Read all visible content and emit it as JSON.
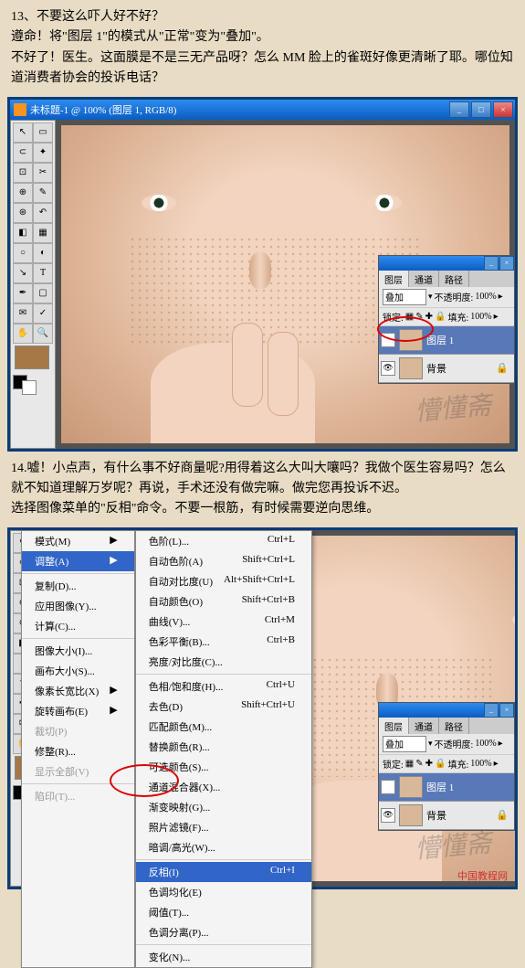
{
  "step13": {
    "heading": "13、不要这么吓人好不好？",
    "line2": "遵命！将\"图层 1\"的模式从\"正常\"变为\"叠加\"。",
    "line3": "不好了！医生。这面膜是不是三无产品呀？怎么 MM 脸上的雀斑好像更清晰了耶。哪位知道消费者协会的投诉电话？"
  },
  "step14": {
    "line1": "14.嘘！小点声，有什么事不好商量呢?用得着这么大叫大嚷吗？我做个医生容易吗？怎么就不知道理解万岁呢？再说，手术还没有做完嘛。做完您再投诉不迟。",
    "line2": "选择图像菜单的\"反相\"命令。不要一根筋，有时候需要逆向思维。"
  },
  "window": {
    "title": "未标题-1 @ 100% (图层 1, RGB/8)"
  },
  "layers": {
    "tab1": "图层",
    "tab2": "通道",
    "tab3": "路径",
    "blend": "叠加",
    "opacity_label": "不透明度:",
    "opacity": "100%",
    "lock_label": "锁定:",
    "fill_label": "填充:",
    "fill": "100%",
    "layer1": "图层 1",
    "background": "背景"
  },
  "menu1": {
    "items": [
      {
        "l": "模式(M)",
        "a": "▶"
      },
      {
        "l": "调整(A)",
        "a": "▶",
        "sel": true
      },
      {
        "sep": true
      },
      {
        "l": "复制(D)...",
        "a": ""
      },
      {
        "l": "应用图像(Y)...",
        "a": ""
      },
      {
        "l": "计算(C)...",
        "a": ""
      },
      {
        "sep": true
      },
      {
        "l": "图像大小(I)...",
        "a": ""
      },
      {
        "l": "画布大小(S)...",
        "a": ""
      },
      {
        "l": "像素长宽比(X)",
        "a": "▶"
      },
      {
        "l": "旋转画布(E)",
        "a": "▶"
      },
      {
        "l": "裁切(P)",
        "a": "",
        "dis": true
      },
      {
        "l": "修整(R)...",
        "a": ""
      },
      {
        "l": "显示全部(V)",
        "a": "",
        "dis": true
      },
      {
        "sep": true
      },
      {
        "l": "陷印(T)...",
        "a": "",
        "dis": true
      }
    ]
  },
  "menu2": {
    "items": [
      {
        "l": "色阶(L)...",
        "s": "Ctrl+L"
      },
      {
        "l": "自动色阶(A)",
        "s": "Shift+Ctrl+L"
      },
      {
        "l": "自动对比度(U)",
        "s": "Alt+Shift+Ctrl+L"
      },
      {
        "l": "自动颜色(O)",
        "s": "Shift+Ctrl+B"
      },
      {
        "l": "曲线(V)...",
        "s": "Ctrl+M"
      },
      {
        "l": "色彩平衡(B)...",
        "s": "Ctrl+B"
      },
      {
        "l": "亮度/对比度(C)...",
        "s": ""
      },
      {
        "sep": true
      },
      {
        "l": "色相/饱和度(H)...",
        "s": "Ctrl+U"
      },
      {
        "l": "去色(D)",
        "s": "Shift+Ctrl+U"
      },
      {
        "l": "匹配颜色(M)...",
        "s": ""
      },
      {
        "l": "替换颜色(R)...",
        "s": ""
      },
      {
        "l": "可选颜色(S)...",
        "s": ""
      },
      {
        "l": "通道混合器(X)...",
        "s": ""
      },
      {
        "l": "渐变映射(G)...",
        "s": ""
      },
      {
        "l": "照片滤镜(F)...",
        "s": ""
      },
      {
        "l": "暗调/高光(W)...",
        "s": ""
      },
      {
        "sep": true
      },
      {
        "l": "反相(I)",
        "s": "Ctrl+I",
        "sel": true
      },
      {
        "l": "色调均化(E)",
        "s": ""
      },
      {
        "l": "阈值(T)...",
        "s": ""
      },
      {
        "l": "色调分离(P)...",
        "s": ""
      },
      {
        "sep": true
      },
      {
        "l": "变化(N)...",
        "s": ""
      }
    ]
  },
  "watermark": "懵懂斋",
  "footer": "中国教程网"
}
